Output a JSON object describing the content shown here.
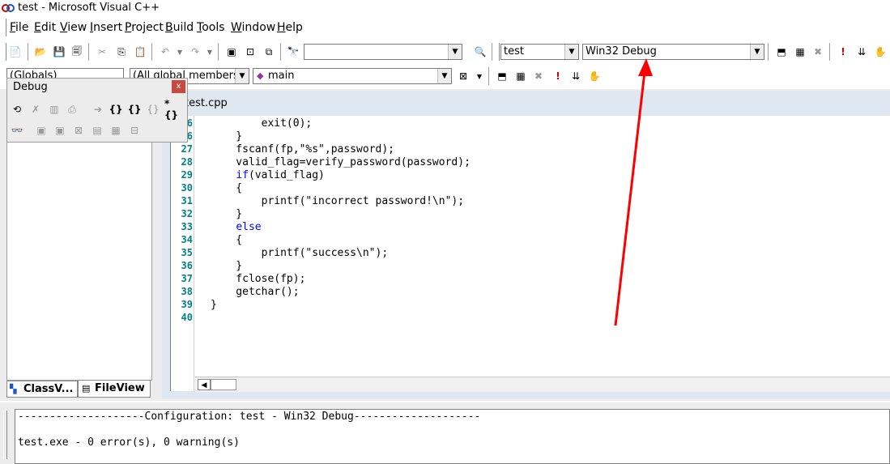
{
  "window": {
    "title": "test - Microsoft Visual C++"
  },
  "menu": [
    "File",
    "Edit",
    "View",
    "Insert",
    "Project",
    "Build",
    "Tools",
    "Window",
    "Help"
  ],
  "toolbar1": {
    "find_combo_value": "",
    "project_combo": "test",
    "config_combo": "Win32 Debug"
  },
  "toolbar2": {
    "scope_combo": "(Globals)",
    "members_combo": "(All global members",
    "function_combo": "main"
  },
  "debug_toolbar": {
    "title": "Debug",
    "close_label": "x"
  },
  "left_pane": {
    "tabs": [
      "ClassV...",
      "FileView"
    ]
  },
  "editor": {
    "tab_label": "test.cpp",
    "lines": [
      {
        "num": "26",
        "code": "        exit(0);"
      },
      {
        "num": "26",
        "code": "    }"
      },
      {
        "num": "27",
        "code": "    fscanf(fp,\"%s\",password);"
      },
      {
        "num": "28",
        "code": "    valid_flag=verify_password(password);"
      },
      {
        "num": "29",
        "kw": "if",
        "code": "(valid_flag)"
      },
      {
        "num": "30",
        "code": "    {"
      },
      {
        "num": "31",
        "code": "        printf(\"incorrect password!\\n\");"
      },
      {
        "num": "32",
        "code": "    }"
      },
      {
        "num": "33",
        "kw": "else",
        "code": ""
      },
      {
        "num": "34",
        "code": "    {"
      },
      {
        "num": "35",
        "code": "        printf(\"success\\n\");"
      },
      {
        "num": "36",
        "code": "    }"
      },
      {
        "num": "37",
        "code": "    fclose(fp);"
      },
      {
        "num": "38",
        "code": "    getchar();"
      },
      {
        "num": "39",
        "code": "}"
      },
      {
        "num": "40",
        "code": ""
      }
    ]
  },
  "output": {
    "line1": "--------------------Configuration: test - Win32 Debug--------------------",
    "line2": "",
    "line3": "test.exe - 0 error(s), 0 warning(s)"
  },
  "colors": {
    "annotation_arrow": "#ff0000",
    "line_numbers": "#00808a",
    "keyword": "#0000ff"
  }
}
